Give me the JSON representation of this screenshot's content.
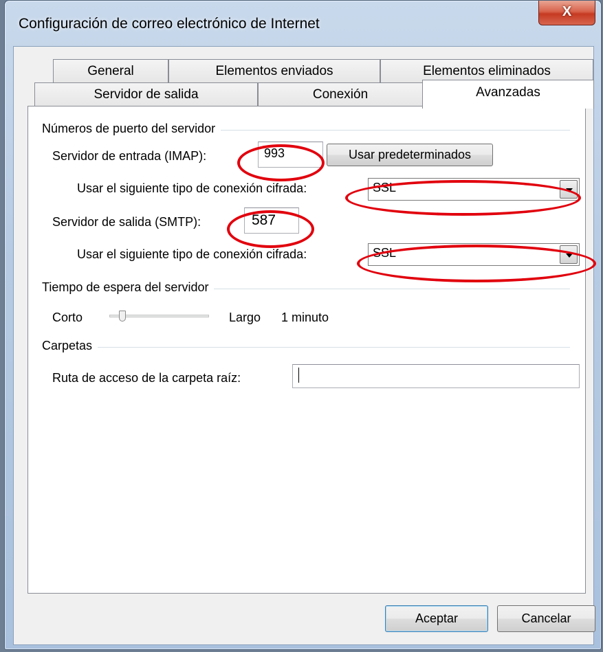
{
  "window": {
    "title": "Configuración de correo electrónico de Internet",
    "close_label": "X"
  },
  "tabs": {
    "row_back": [
      "General",
      "Elementos enviados",
      "Elementos eliminados"
    ],
    "row_front": [
      "Servidor de salida",
      "Conexión",
      "Avanzadas"
    ],
    "active": "Avanzadas"
  },
  "ports": {
    "group_title": "Números de puerto del servidor",
    "incoming_label": "Servidor de entrada (IMAP):",
    "incoming_value": "993",
    "defaults_button": "Usar predeterminados",
    "incoming_encryption_label": "Usar el siguiente tipo de conexión cifrada:",
    "incoming_encryption_value": "SSL",
    "outgoing_label": "Servidor de salida (SMTP):",
    "outgoing_value": "587",
    "outgoing_encryption_label": "Usar el siguiente tipo de conexión cifrada:",
    "outgoing_encryption_value": "SSL"
  },
  "timeout": {
    "group_title": "Tiempo de espera del servidor",
    "short_label": "Corto",
    "long_label": "Largo",
    "value_text": "1 minuto",
    "slider_level": 0.1
  },
  "folders": {
    "group_title": "Carpetas",
    "root_path_label": "Ruta de acceso de la carpeta raíz:",
    "root_path_value": ""
  },
  "footer": {
    "ok_button": "Aceptar",
    "cancel_button": "Cancelar"
  },
  "annotations": {
    "highlight_color": "#e1000d"
  }
}
